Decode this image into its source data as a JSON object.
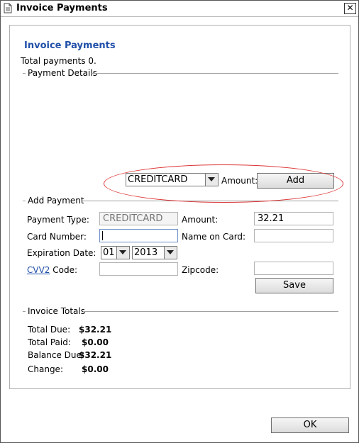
{
  "window": {
    "title": "Invoice Payments",
    "close_glyph": "✕",
    "icon": "document-icon"
  },
  "page": {
    "heading": "Invoice Payments",
    "total_payments": "Total payments 0."
  },
  "payment_details": {
    "legend": "Payment Details",
    "method_select_value": "CREDITCARD",
    "amount_label": "Amount:",
    "add_label": "Add"
  },
  "add_payment": {
    "legend": "Add Payment",
    "payment_type_label": "Payment Type:",
    "payment_type_value": "CREDITCARD",
    "amount_label": "Amount:",
    "amount_value": "32.21",
    "card_number_label": "Card Number:",
    "card_number_value": "",
    "name_on_card_label": "Name on Card:",
    "name_on_card_value": "",
    "expiration_label": "Expiration Date:",
    "exp_month": "01",
    "exp_year": "2013",
    "cvv_link": "CVV2",
    "cvv_label": " Code:",
    "cvv_value": "",
    "zipcode_label": "Zipcode:",
    "zipcode_value": "",
    "save_label": "Save"
  },
  "invoice_totals": {
    "legend": "Invoice Totals",
    "rows": [
      {
        "label": "Total Due:",
        "value": "$32.21"
      },
      {
        "label": "Total Paid:",
        "value": "$0.00"
      },
      {
        "label": "Balance Due:",
        "value": "$32.21"
      },
      {
        "label": "Change:",
        "value": "$0.00"
      }
    ]
  },
  "footer": {
    "ok_label": "OK"
  },
  "colors": {
    "heading": "#1f4fa8",
    "annotation_oval": "#dd3333"
  }
}
